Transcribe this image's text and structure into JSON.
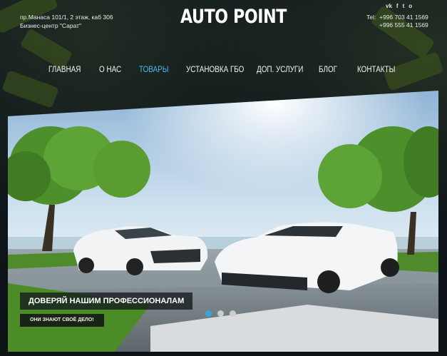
{
  "header": {
    "address_line1": "пр.Манаса 101/1, 2 этаж, каб 306",
    "address_line2": "Бизнес-центр \"Сарат\"",
    "logo": "AUTO POINT",
    "phone_label": "Tel:",
    "phone1": "+996 703 41 1569",
    "phone2": "+996 555 41 1569",
    "social": [
      {
        "icon": "vk-icon",
        "glyph": "vk"
      },
      {
        "icon": "facebook-icon",
        "glyph": "f"
      },
      {
        "icon": "twitter-icon",
        "glyph": "t"
      },
      {
        "icon": "odnoklassniki-icon",
        "glyph": "o"
      }
    ]
  },
  "nav": {
    "items": [
      {
        "label": "ГЛАВНАЯ"
      },
      {
        "label": "О НАС"
      },
      {
        "label": "ТОВАРЫ"
      },
      {
        "label": "УСТАНОВКА ГБО"
      },
      {
        "label": "ДОП. УСЛУГИ"
      },
      {
        "label": "БЛОГ"
      },
      {
        "label": "КОНТАКТЫ"
      }
    ],
    "active_index": 2
  },
  "slider": {
    "caption": "ДОВЕРЯЙ НАШИМ ПРОФЕССИОНАЛАМ",
    "subcaption": "ОНИ ЗНАЮТ СВОЁ ДЕЛО!",
    "slide_count": 3,
    "active_slide": 1
  },
  "colors": {
    "accent": "#35a6e0",
    "nav_active": "#4fb6e8",
    "background": "#0e1418"
  }
}
